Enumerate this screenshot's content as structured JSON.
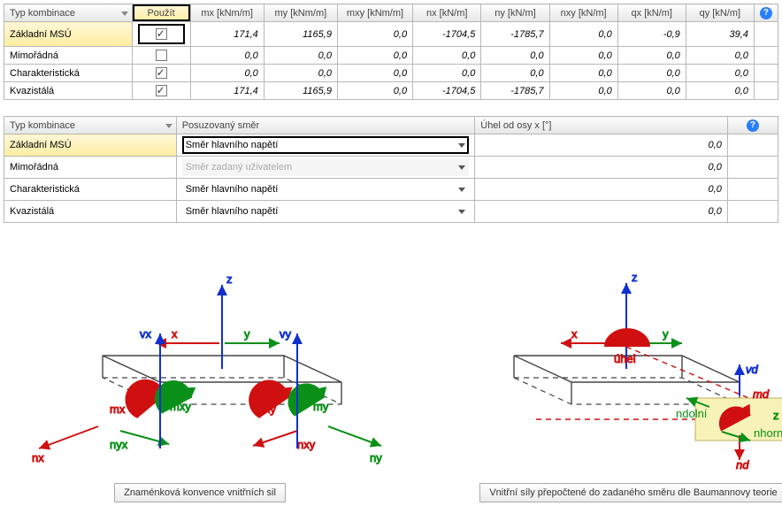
{
  "table1": {
    "headers": {
      "typ": "Typ kombinace",
      "pouzit": "Použít",
      "mx": "mx [kNm/m]",
      "my": "my [kNm/m]",
      "mxy": "mxy [kNm/m]",
      "nx": "nx [kN/m]",
      "ny": "ny [kN/m]",
      "nxy": "nxy [kN/m]",
      "qx": "qx [kN/m]",
      "qy": "qy [kN/m]"
    },
    "rows": [
      {
        "name": "Základní MSÚ",
        "hl": true,
        "use": true,
        "vals": [
          "171,4",
          "1165,9",
          "0,0",
          "-1704,5",
          "-1785,7",
          "0,0",
          "-0,9",
          "39,4"
        ]
      },
      {
        "name": "Mimořádná",
        "hl": false,
        "use": false,
        "vals": [
          "0,0",
          "0,0",
          "0,0",
          "0,0",
          "0,0",
          "0,0",
          "0,0",
          "0,0"
        ]
      },
      {
        "name": "Charakteristická",
        "hl": false,
        "use": true,
        "vals": [
          "0,0",
          "0,0",
          "0,0",
          "0,0",
          "0,0",
          "0,0",
          "0,0",
          "0,0"
        ]
      },
      {
        "name": "Kvazistálá",
        "hl": false,
        "use": true,
        "vals": [
          "171,4",
          "1165,9",
          "0,0",
          "-1704,5",
          "-1785,7",
          "0,0",
          "0,0",
          "0,0"
        ]
      }
    ]
  },
  "table2": {
    "headers": {
      "typ": "Typ kombinace",
      "smer": "Posuzovaný směr",
      "uhel": "Úhel od osy x [°]"
    },
    "options": {
      "hlavni": "Směr hlavního napětí",
      "uzivatel": "Směr zadaný uživatelem"
    },
    "rows": [
      {
        "name": "Základní MSÚ",
        "hl": true,
        "opt": "hlavni",
        "disabled": false,
        "boxhl": true,
        "angle": "0,0"
      },
      {
        "name": "Mimořádná",
        "hl": false,
        "opt": "uzivatel",
        "disabled": true,
        "boxhl": false,
        "angle": "0,0"
      },
      {
        "name": "Charakteristická",
        "hl": false,
        "opt": "hlavni",
        "disabled": false,
        "boxhl": false,
        "angle": "0,0"
      },
      {
        "name": "Kvazistálá",
        "hl": false,
        "opt": "hlavni",
        "disabled": false,
        "boxhl": false,
        "angle": "0,0"
      }
    ]
  },
  "diagrams": {
    "left": {
      "caption": "Znaménková konvence vnitřních sil",
      "labels": {
        "z": "z",
        "x": "x",
        "y": "y",
        "vx": "vx",
        "vy": "vy",
        "mx": "mx",
        "mxy": "mxy",
        "mxy2": "mxy",
        "my": "my",
        "nx": "nx",
        "nyx": "nyx",
        "nxy": "nxy",
        "ny": "ny"
      }
    },
    "right": {
      "caption": "Vnitřní síly přepočtené do zadaného směru dle Baumannovy teorie",
      "labels": {
        "z": "z",
        "x": "x",
        "y": "y",
        "uhel": "úhel",
        "vd": "vd",
        "md": "md",
        "nd": "nd",
        "ndolni": "ndolní",
        "nhorni": "nhorní",
        "zlbl": "z"
      }
    }
  }
}
